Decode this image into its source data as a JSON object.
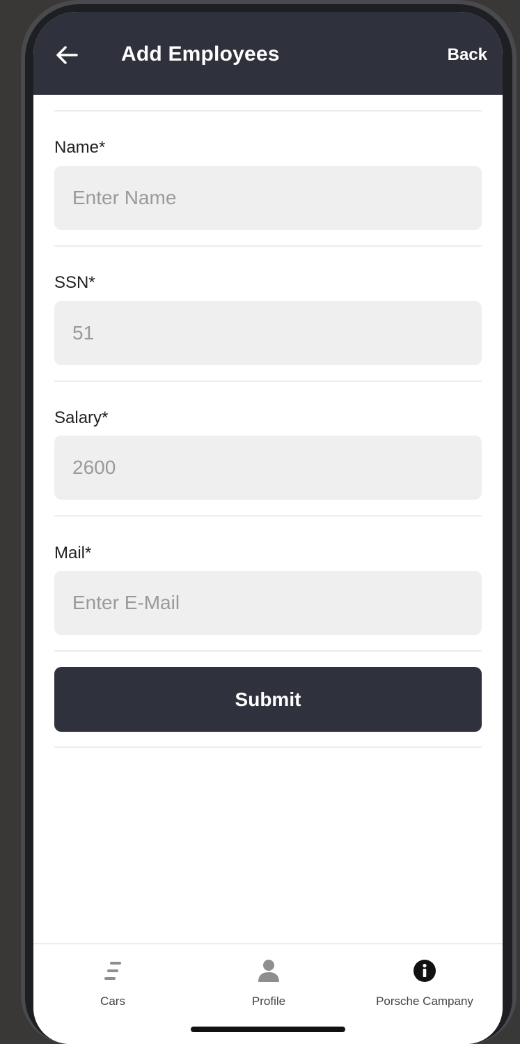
{
  "header": {
    "title": "Add Employees",
    "back_label": "Back"
  },
  "form": {
    "name": {
      "label": "Name*",
      "placeholder": "Enter Name",
      "value": ""
    },
    "ssn": {
      "label": "SSN*",
      "placeholder": "",
      "value": "51"
    },
    "salary": {
      "label": "Salary*",
      "placeholder": "",
      "value": "2600"
    },
    "mail": {
      "label": "Mail*",
      "placeholder": "Enter E-Mail",
      "value": ""
    },
    "submit_label": "Submit"
  },
  "tabbar": {
    "items": [
      {
        "label": "Cars",
        "icon": "menu-lines-icon"
      },
      {
        "label": "Profile",
        "icon": "person-icon"
      },
      {
        "label": "Porsche Campany",
        "icon": "info-icon"
      }
    ]
  },
  "colors": {
    "header_bg": "#2f313c",
    "field_bg": "#efefef",
    "accent": "#2f313c"
  }
}
